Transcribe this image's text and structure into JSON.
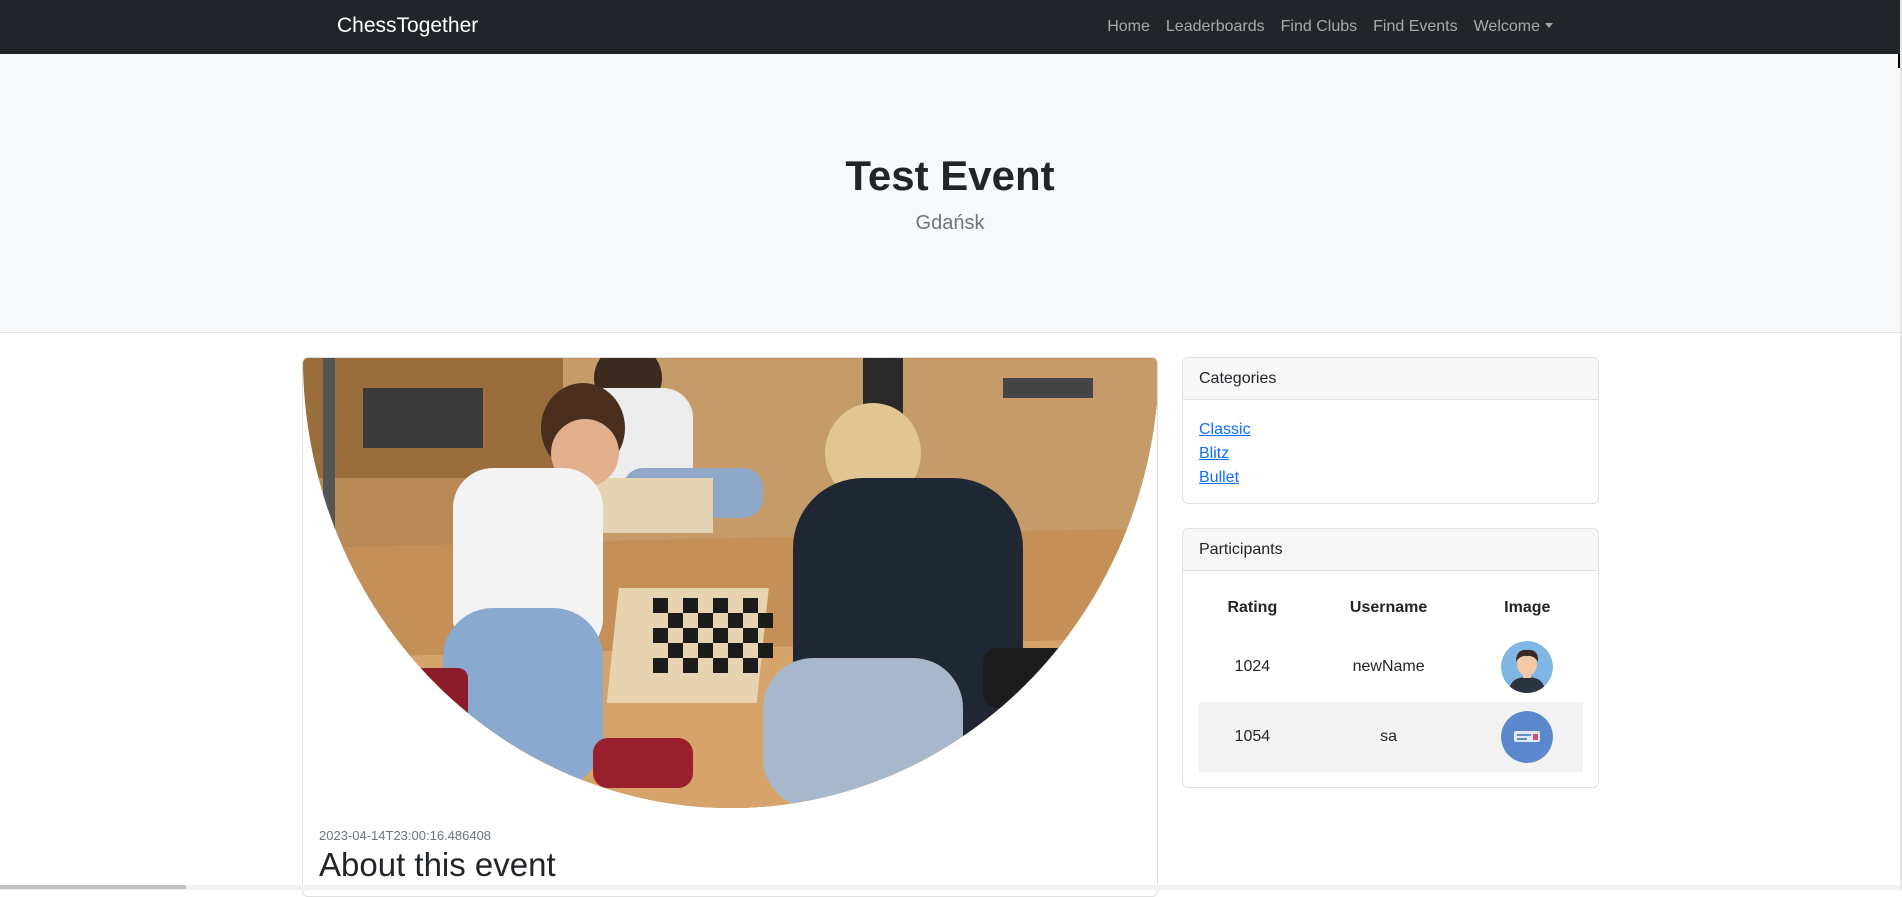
{
  "navbar": {
    "brand": "ChessTogether",
    "links": [
      "Home",
      "Leaderboards",
      "Find Clubs",
      "Find Events",
      "Welcome"
    ],
    "background": "#212529"
  },
  "hero": {
    "title": "Test Event",
    "location": "Gdańsk",
    "background": "#f8f9fa"
  },
  "event": {
    "image_icon": "chess-players-photo",
    "date": "2023-04-14T23:00:16.486408",
    "about_heading": "About this event"
  },
  "categories": {
    "header": "Categories",
    "items": [
      "Classic",
      "Blitz",
      "Bullet"
    ],
    "link_color": "#0d6efd"
  },
  "participants": {
    "header": "Participants",
    "columns": [
      "Rating",
      "Username",
      "Image"
    ],
    "rows": [
      {
        "rating": "1024",
        "username": "newName",
        "avatar": "male-avatar-icon"
      },
      {
        "rating": "1054",
        "username": "sa",
        "avatar": "blue-badge-avatar-icon"
      }
    ]
  }
}
